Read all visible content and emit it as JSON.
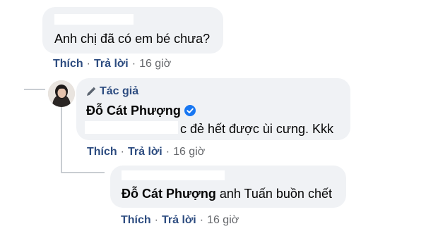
{
  "comments": [
    {
      "text": "Anh chị đã có em bé chưa?",
      "actions": {
        "like": "Thích",
        "reply": "Trả lời",
        "sep": "·",
        "time": "16 giờ"
      }
    },
    {
      "author_badge": "Tác giả",
      "author_name": "Đỗ Cát Phượng",
      "text": "c đẻ hết được ùi cưng. Kkk",
      "actions": {
        "like": "Thích",
        "reply": "Trả lời",
        "sep": "·",
        "time": "16 giờ"
      }
    },
    {
      "mention": "Đỗ Cát Phượng",
      "text": " anh Tuấn buồn chết",
      "actions": {
        "like": "Thích",
        "reply": "Trả lời",
        "sep": "·",
        "time": "16 giờ"
      }
    }
  ],
  "icons": {
    "pencil": "pencil-icon",
    "verified": "verified-badge-icon"
  },
  "colors": {
    "bubble": "#f0f2f5",
    "action": "#2d4c80",
    "meta": "#65676b",
    "verified": "#1877f2"
  }
}
